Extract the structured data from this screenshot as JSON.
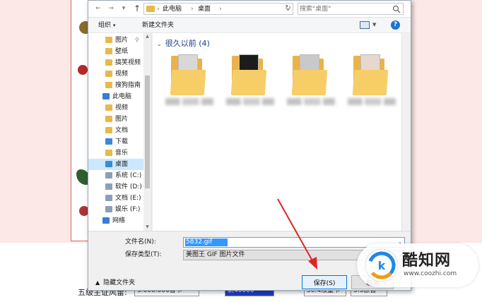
{
  "address_bar": {
    "crumbs": [
      "此电脑",
      "桌面"
    ],
    "search_placeholder": "搜索\"桌面\""
  },
  "toolbar": {
    "organize": "组织",
    "new_folder": "新建文件夹"
  },
  "nav_pane": {
    "items": [
      {
        "label": "图片",
        "icon": "pictures-icon",
        "color": "#e8b94a",
        "pinned": true
      },
      {
        "label": "壁纸",
        "icon": "folder-icon",
        "color": "#e8b94a"
      },
      {
        "label": "搞笑视频",
        "icon": "folder-icon",
        "color": "#e8b94a"
      },
      {
        "label": "视频",
        "icon": "folder-icon",
        "color": "#e8b94a"
      },
      {
        "label": "搜狗指南",
        "icon": "folder-icon",
        "color": "#e8b94a"
      },
      {
        "label": "此电脑",
        "icon": "computer-icon",
        "color": "#3a7bd5"
      },
      {
        "label": "视频",
        "icon": "videos-icon",
        "color": "#e8b94a"
      },
      {
        "label": "图片",
        "icon": "pictures-icon",
        "color": "#e8b94a"
      },
      {
        "label": "文档",
        "icon": "documents-icon",
        "color": "#e8b94a"
      },
      {
        "label": "下载",
        "icon": "downloads-icon",
        "color": "#3a8bd5"
      },
      {
        "label": "音乐",
        "icon": "music-icon",
        "color": "#e8b94a"
      },
      {
        "label": "桌面",
        "icon": "desktop-icon",
        "color": "#3a8bd5",
        "selected": true
      },
      {
        "label": "系统 (C:)",
        "icon": "drive-icon",
        "color": "#8aa0b8"
      },
      {
        "label": "软件 (D:)",
        "icon": "drive-icon",
        "color": "#8aa0b8"
      },
      {
        "label": "文档 (E:)",
        "icon": "drive-icon",
        "color": "#8aa0b8"
      },
      {
        "label": "娱乐 (F:)",
        "icon": "drive-icon",
        "color": "#8aa0b8"
      },
      {
        "label": "网络",
        "icon": "network-icon",
        "color": "#3a7bd5"
      }
    ]
  },
  "content": {
    "group_title": "很久以前 (4)",
    "files": [
      {
        "thumb_color": "#d8d8d8"
      },
      {
        "thumb_color": "#1c1c1c"
      },
      {
        "thumb_color": "#c9c9c9"
      },
      {
        "thumb_color": "#e6d8cf"
      }
    ]
  },
  "form": {
    "filename_label": "文件名(N):",
    "filename_value": "5832.gif",
    "filetype_label": "保存类型(T):",
    "filetype_value": "美图王 GIF 图片文件",
    "hide_folders": "隐藏文件夹",
    "save_label": "保存(S)",
    "cancel_label": "取消"
  },
  "background_page": {
    "label": "五级主证风雷:",
    "fields": [
      "3.000.000音卡",
      "新40000",
      "50.4限量卡",
      "5.5原音"
    ]
  },
  "watermark": {
    "title": "酷知网",
    "url": "www.coozhi.com"
  },
  "colors": {
    "accent": "#0078d7",
    "arrow": "#e02424",
    "folder": "#e9b34a"
  }
}
